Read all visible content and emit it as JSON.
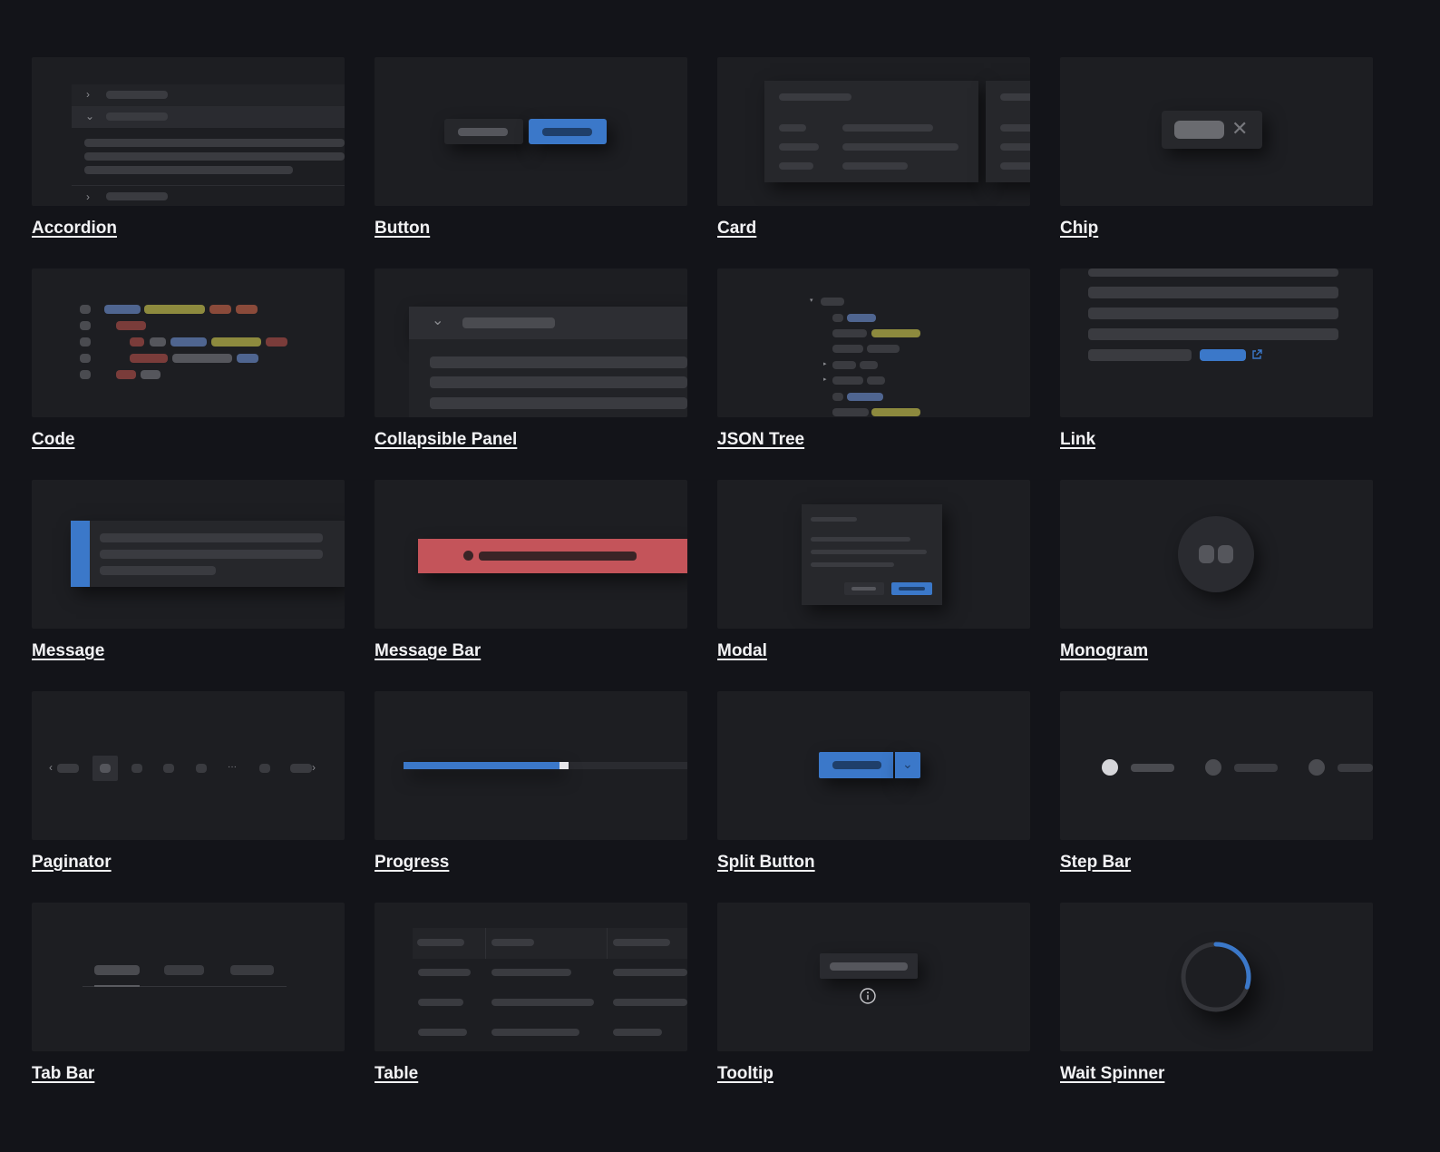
{
  "components": [
    {
      "id": "accordion",
      "label": "Accordion"
    },
    {
      "id": "button",
      "label": "Button"
    },
    {
      "id": "card",
      "label": "Card"
    },
    {
      "id": "chip",
      "label": "Chip"
    },
    {
      "id": "code",
      "label": "Code"
    },
    {
      "id": "collapsible-panel",
      "label": "Collapsible Panel"
    },
    {
      "id": "json-tree",
      "label": "JSON Tree"
    },
    {
      "id": "link",
      "label": "Link"
    },
    {
      "id": "message",
      "label": "Message"
    },
    {
      "id": "message-bar",
      "label": "Message Bar"
    },
    {
      "id": "modal",
      "label": "Modal"
    },
    {
      "id": "monogram",
      "label": "Monogram"
    },
    {
      "id": "paginator",
      "label": "Paginator"
    },
    {
      "id": "progress",
      "label": "Progress"
    },
    {
      "id": "split-button",
      "label": "Split Button"
    },
    {
      "id": "step-bar",
      "label": "Step Bar"
    },
    {
      "id": "tab-bar",
      "label": "Tab Bar"
    },
    {
      "id": "table",
      "label": "Table"
    },
    {
      "id": "tooltip",
      "label": "Tooltip"
    },
    {
      "id": "wait-spinner",
      "label": "Wait Spinner"
    }
  ],
  "progress": {
    "fraction": 0.55
  },
  "paginator": {
    "ellipsis": "···"
  },
  "wait_spinner": {
    "arc_fraction": 0.3
  },
  "colors": {
    "background": "#131419",
    "tile": "#1d1e22",
    "placeholder": "#3a3b40",
    "accent_blue": "#3b78c9",
    "danger_red": "#c4545a",
    "code_olive": "#8d8a3e",
    "code_rust": "#8a4a3a",
    "code_slate": "#4f6590"
  },
  "icons": [
    "chevron-right-icon",
    "chevron-down-icon",
    "close-icon",
    "external-link-icon",
    "info-icon",
    "caret-down-icon"
  ]
}
